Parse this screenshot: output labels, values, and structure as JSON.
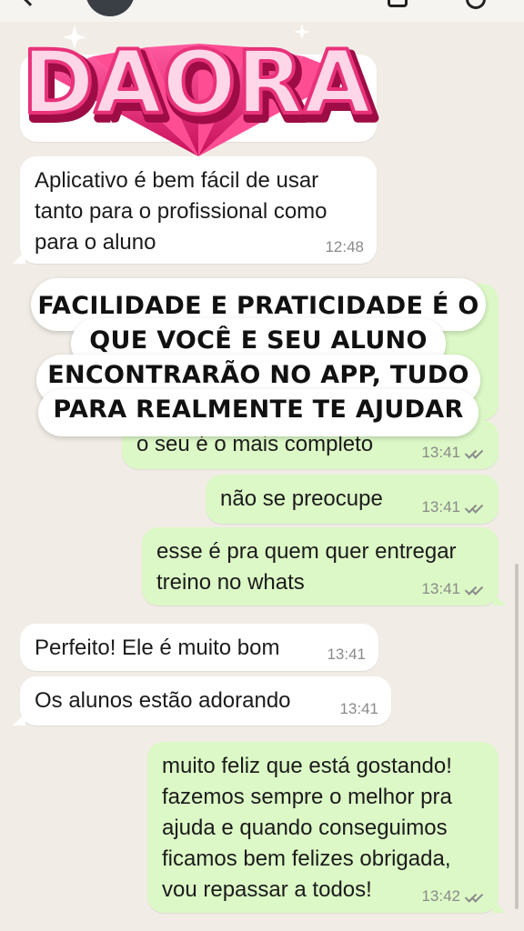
{
  "sticker": {
    "text": "DAORA"
  },
  "caption": {
    "text": "FACILIDADE E PRATICIDADE É O\nQUE VOCÊ E SEU ALUNO\nENCONTRARÃO NO APP, TUDO\nPARA REALMENTE TE AJUDAR"
  },
  "messages": [
    {
      "direction": "in",
      "text": "Aplicativo é bem fácil de usar\ntanto para o profissional como\npara o aluno",
      "time": "12:48"
    },
    {
      "direction": "out",
      "text": "o seu é o mais completo",
      "time": "13:41",
      "status": "read"
    },
    {
      "direction": "out",
      "text": "não se preocupe",
      "time": "13:41",
      "status": "read"
    },
    {
      "direction": "out",
      "text": "esse é pra quem quer entregar\ntreino no whats",
      "time": "13:41",
      "status": "read"
    },
    {
      "direction": "in",
      "text": "Perfeito! Ele é muito bom",
      "time": "13:41"
    },
    {
      "direction": "in",
      "text": "Os alunos estão adorando",
      "time": "13:41"
    },
    {
      "direction": "out",
      "text": "muito feliz que está gostando!\nfazemos sempre o melhor pra\najuda e quando conseguimos\nficamos bem felizes obrigada,\nvou repassar a todos!",
      "time": "13:42",
      "status": "read"
    }
  ],
  "colors": {
    "background": "#f1ede6",
    "incoming_bubble": "#ffffff",
    "outgoing_bubble": "#dcf8c6",
    "sticker_pink": "#e8327a"
  }
}
